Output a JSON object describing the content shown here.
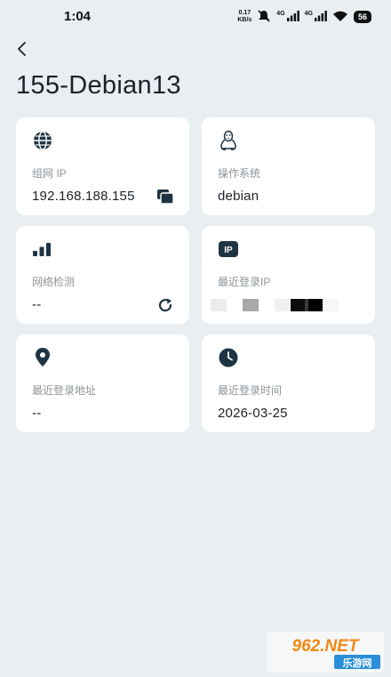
{
  "status_bar": {
    "time": "1:04",
    "speed_value": "0.17",
    "speed_unit": "KB/s",
    "net1": "4G",
    "net2": "4G",
    "battery": "56"
  },
  "header": {
    "title": "155-Debian13"
  },
  "cards": {
    "network_ip": {
      "icon": "globe-icon",
      "label": "组网 IP",
      "value": "192.168.188.155",
      "action_icon": "copy-icon"
    },
    "os": {
      "icon": "linux-tux-icon",
      "label": "操作系统",
      "value": "debian"
    },
    "network_check": {
      "icon": "signal-bars-icon",
      "label": "网络检测",
      "value": "--",
      "action_icon": "refresh-icon"
    },
    "last_login_ip": {
      "icon": "ip-badge-icon",
      "icon_text": "IP",
      "label": "最近登录IP"
    },
    "last_login_address": {
      "icon": "location-pin-icon",
      "label": "最近登录地址",
      "value": "--"
    },
    "last_login_time": {
      "icon": "clock-icon",
      "label": "最近登录时间",
      "value": "2026-03-25"
    }
  },
  "watermark": {
    "text_top": "962.NET",
    "text_bottom": "乐游网"
  },
  "colors": {
    "background": "#e8eef1",
    "card": "#ffffff",
    "icon_dark": "#1f3442",
    "label_gray": "#8d9499"
  }
}
